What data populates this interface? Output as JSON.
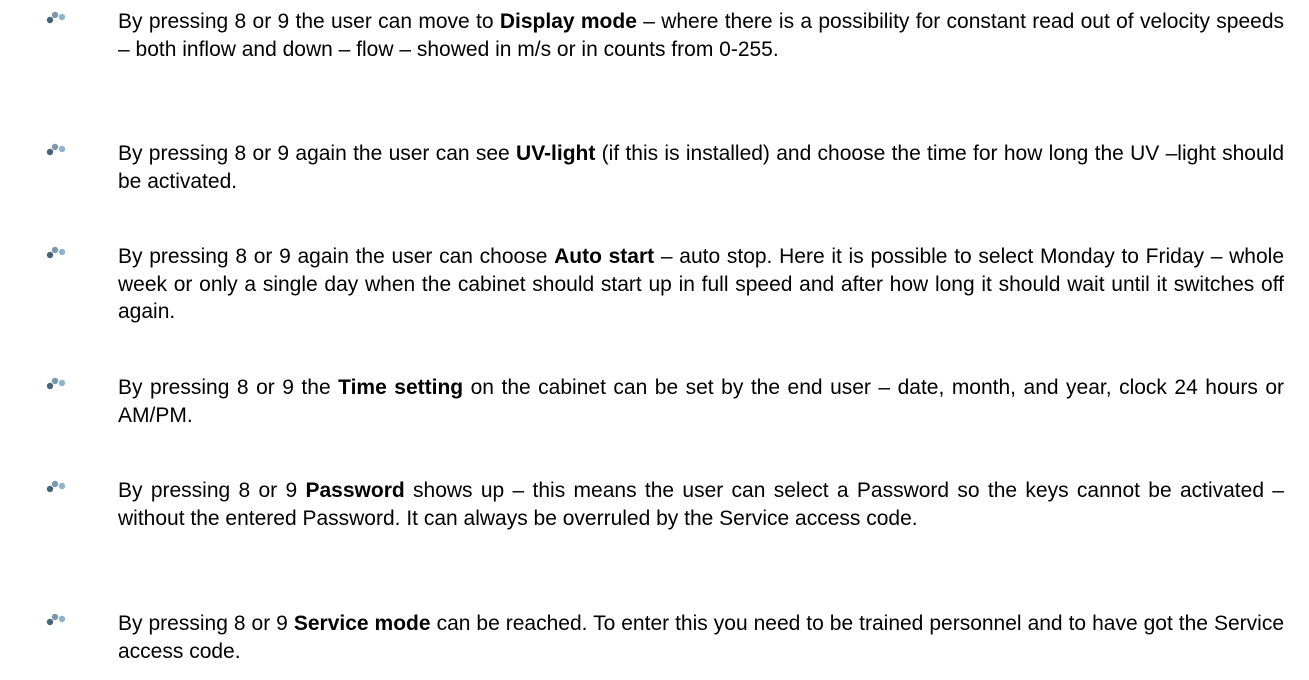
{
  "bullet_icon": "cluster-bullet-icon",
  "colors": {
    "text": "#000000",
    "bullet_dark": "#4a6478",
    "bullet_light": "#8fb3cc"
  },
  "items": [
    {
      "pre": "By pressing 8 or 9 the user can move to ",
      "bold": "Display mode",
      "post": " – where there is a possibility for constant read out of velocity speeds – both inflow and down – flow – showed in m/s or in counts from 0-255."
    },
    {
      "pre": "By pressing 8 or 9 again the user can see ",
      "bold": "UV-light",
      "post": " (if this is installed) and choose the time for how long the UV –light should be activated."
    },
    {
      "pre": "By pressing 8 or 9 again the user can choose ",
      "bold": "Auto start",
      "post": " – auto stop. Here it is possible to select Monday to Friday – whole week or only a single day when the cabinet should start up in full speed and after how long it should wait until it switches off again."
    },
    {
      "pre": "By pressing 8 or 9 the ",
      "bold": "Time setting",
      "post": " on the cabinet can be set by the end user – date, month, and year, clock 24 hours or AM/PM."
    },
    {
      "pre": "By pressing 8 or 9 ",
      "bold": "Password",
      "post": " shows up – this means the user can select a Password so the keys cannot be activated – without the entered Password. It can always be overruled by the Service access code."
    },
    {
      "pre": "By pressing 8 or 9 ",
      "bold": "Service mode",
      "post": " can be reached. To enter this you need to be trained personnel and to have got the Service access code."
    }
  ]
}
